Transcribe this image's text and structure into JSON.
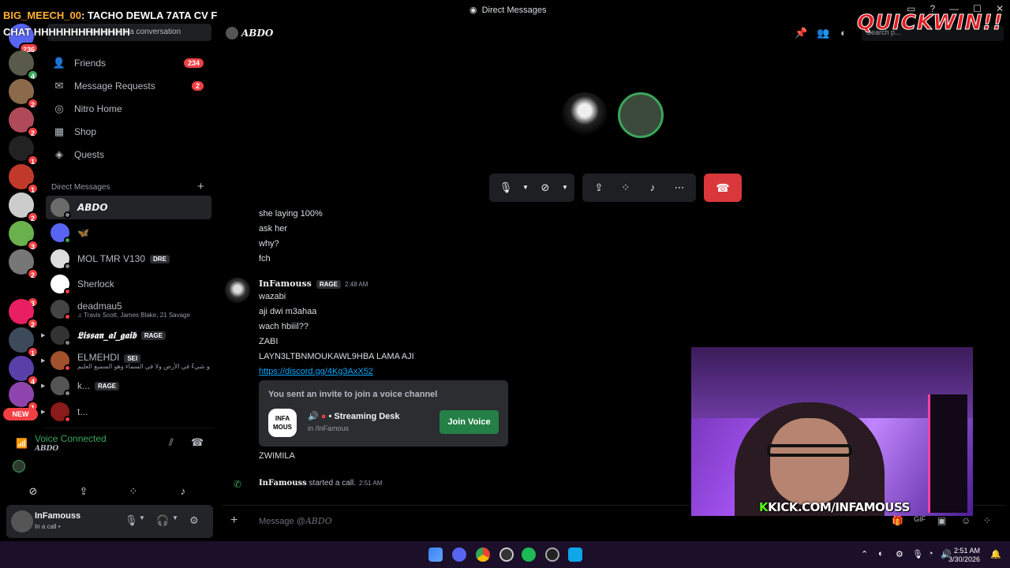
{
  "window": {
    "title": "Direct Messages"
  },
  "overlay": {
    "chat_user": "BIG_MEECH_00",
    "chat_text": ": TACHO DEWLA 7ATA CV F CHAT HHHHHHHHHHHHH",
    "sponsor": "QUICKWIN!!",
    "kick_k": "K",
    "kick_url": "KICK.COM/INFAMOUSS"
  },
  "rail": {
    "home_badge": "236",
    "servers": [
      {
        "badge": "4"
      },
      {
        "badge": "2"
      },
      {
        "badge": "2"
      },
      {
        "badge": "1"
      },
      {
        "badge": "1"
      },
      {
        "badge": "2"
      },
      {
        "badge": "3"
      },
      {
        "badge": "2"
      },
      {
        "badge": "3"
      },
      {
        "badge": "2"
      },
      {
        "badge": "1"
      },
      {
        "badge": "4"
      },
      {
        "badge": "1"
      }
    ],
    "new_label": "NEW"
  },
  "sidebar": {
    "search_placeholder": "Find or start a conversation",
    "nav": [
      {
        "label": "Friends",
        "icon": "friends-icon",
        "count": "234"
      },
      {
        "label": "Message Requests",
        "icon": "mail-icon",
        "count": "2"
      },
      {
        "label": "Nitro Home",
        "icon": "nitro-icon",
        "count": ""
      },
      {
        "label": "Shop",
        "icon": "shop-icon",
        "count": ""
      },
      {
        "label": "Quests",
        "icon": "quests-icon",
        "count": ""
      }
    ],
    "dm_heading": "Direct Messages",
    "dms": [
      {
        "name": "𝘼𝘽𝘿𝙊",
        "sub": "",
        "tag": ""
      },
      {
        "name": "🦋",
        "sub": "",
        "tag": ""
      },
      {
        "name": "MOL TMR V130",
        "sub": "",
        "tag": "DRE"
      },
      {
        "name": "Sherlock",
        "sub": "",
        "tag": ""
      },
      {
        "name": "deadmau5",
        "sub": "♫ Travis Scott, James Blake, 21 Savage",
        "tag": ""
      },
      {
        "name": "𝕷𝖎𝖘𝖘𝖆𝖓_𝖆𝖑_𝖌𝖆𝖎𝖇",
        "sub": "",
        "tag": "RAGE"
      },
      {
        "name": "ELMEHDI",
        "sub": "وهو شيءٌ في الأرض ولا في السماء وهو السميع العليم...",
        "tag": "SEI"
      },
      {
        "name": "k...",
        "sub": "",
        "tag": "RAGE"
      },
      {
        "name": "t...",
        "sub": "",
        "tag": ""
      }
    ]
  },
  "voice": {
    "status": "Voice Connected",
    "channel": "ABDO"
  },
  "user": {
    "name": "InFamouss",
    "status": "In a call •"
  },
  "header": {
    "channel": "ABDO",
    "search_placeholder": "Search p..."
  },
  "messages": {
    "earlier": [
      "she laying 100%",
      "ask her",
      "why?",
      "fch"
    ],
    "author": "InFamouss",
    "author_tag": "RAGE",
    "time": "2:48 AM",
    "lines": [
      "wazabi",
      "aji dwi m3ahaa",
      "wach hbiiil??",
      "ZABI",
      "LAYN3LTBNMOUKAWL9HBA LAMA AJI"
    ],
    "link": "https://discord.gg/4Kg3AxX52",
    "invite": {
      "heading": "You sent an invite to join a voice channel",
      "icon_text": "INFA MOUS",
      "channel": "• Streaming Desk",
      "server": "in /InFamous",
      "button": "Join Voice"
    },
    "after": "ZWIMILA",
    "call_log_user": "InFamouss",
    "call_log_text": " started a call.",
    "call_log_time": "2:51 AM"
  },
  "composer": {
    "placeholder_prefix": "Message @",
    "placeholder_name": "ABDO"
  },
  "taskbar": {
    "time": "2:51 AM",
    "date": "3/30/2026"
  },
  "colors": {
    "accent_red": "#da373c",
    "join_green": "#248046",
    "link_blue": "#00a8fc",
    "badge_red": "#f23f43",
    "voice_green": "#3ba55c"
  }
}
